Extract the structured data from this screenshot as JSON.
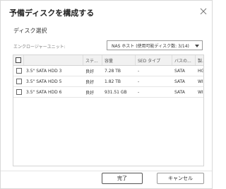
{
  "dialog": {
    "title": "予備ディスクを構成する"
  },
  "section": {
    "title": "ディスク選択"
  },
  "enclosure": {
    "label": "エンクロージャーユニット:",
    "selected": "NAS ホスト (使用可能ディスク数: 3/14)"
  },
  "table": {
    "headers": [
      "",
      "ステ...",
      "容量",
      "SED タイプ",
      "バスの...",
      "製..."
    ],
    "rows": [
      {
        "name": "3.5\" SATA HDD 3",
        "status": "良好",
        "capacity": "7.28 TB",
        "sed": "-",
        "bus": "SATA",
        "vendor": "HG"
      },
      {
        "name": "3.5\" SATA HDD 5",
        "status": "良好",
        "capacity": "1.82 TB",
        "sed": "-",
        "bus": "SATA",
        "vendor": "WI"
      },
      {
        "name": "3.5\" SATA HDD 6",
        "status": "良好",
        "capacity": "931.51 GB",
        "sed": "-",
        "bus": "SATA",
        "vendor": "WI"
      }
    ]
  },
  "buttons": {
    "finish": "完了",
    "cancel": "キャンセル"
  },
  "icons": {
    "close": "close-icon",
    "dropdown": "chevron-down-icon"
  },
  "colors": {
    "header_bg": "#f1f1f1",
    "border": "#d4d4d4",
    "primary_border": "#555555"
  }
}
